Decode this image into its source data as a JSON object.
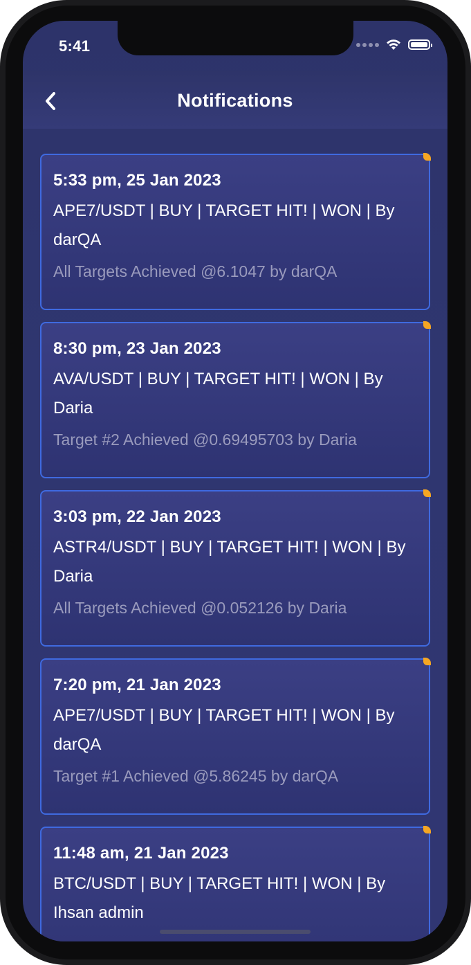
{
  "status_bar": {
    "time": "5:41"
  },
  "header": {
    "title": "Notifications"
  },
  "notifications": [
    {
      "time": "5:33 pm, 25 Jan 2023",
      "message": "APE7/USDT | BUY | TARGET HIT! | WON | By darQA",
      "detail": "All Targets Achieved @6.1047 by darQA"
    },
    {
      "time": "8:30 pm, 23 Jan 2023",
      "message": "AVA/USDT | BUY | TARGET HIT! | WON | By Daria",
      "detail": "Target #2 Achieved @0.69495703 by Daria"
    },
    {
      "time": "3:03 pm, 22 Jan 2023",
      "message": "ASTR4/USDT | BUY | TARGET HIT! | WON | By Daria",
      "detail": "All Targets Achieved @0.052126 by Daria"
    },
    {
      "time": "7:20 pm, 21 Jan 2023",
      "message": "APE7/USDT | BUY | TARGET HIT! | WON | By darQA",
      "detail": "Target #1 Achieved @5.86245 by darQA"
    },
    {
      "time": "11:48 am, 21 Jan 2023",
      "message": "BTC/USDT | BUY | TARGET HIT! | WON | By Ihsan admin",
      "detail": ""
    }
  ],
  "colors": {
    "background": "#2f3570",
    "card_border": "#3f6ae0",
    "unread_dot": "#f5a623",
    "muted_text": "#9a9bbd"
  },
  "icons": {
    "back": "chevron-left-icon",
    "wifi": "wifi-icon",
    "battery": "battery-icon",
    "signal": "cellular-signal-icon"
  }
}
